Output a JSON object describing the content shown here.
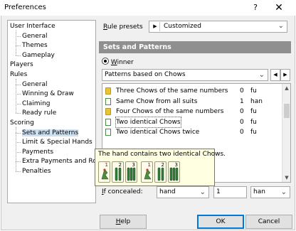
{
  "window": {
    "title": "Preferences",
    "help_glyph": "?",
    "close_glyph": "✕"
  },
  "tree": [
    {
      "label": "User Interface",
      "level": 0
    },
    {
      "label": "General",
      "level": 1
    },
    {
      "label": "Themes",
      "level": 1
    },
    {
      "label": "Gameplay",
      "level": 1
    },
    {
      "label": "Players",
      "level": 0
    },
    {
      "label": "Rules",
      "level": 0
    },
    {
      "label": "General",
      "level": 1
    },
    {
      "label": "Winning & Draw",
      "level": 1
    },
    {
      "label": "Claiming",
      "level": 1
    },
    {
      "label": "Ready rule",
      "level": 1
    },
    {
      "label": "Scoring",
      "level": 0
    },
    {
      "label": "Sets and Patterns",
      "level": 1,
      "selected": true
    },
    {
      "label": "Limit & Special Hands",
      "level": 1
    },
    {
      "label": "Payments",
      "level": 1
    },
    {
      "label": "Extra Payments and Rou",
      "level": 1
    },
    {
      "label": "Penalties",
      "level": 1
    }
  ],
  "rule_presets": {
    "label_underlined": "R",
    "label_rest": "ule presets",
    "value": "Customized"
  },
  "section": {
    "title": "Sets and Patterns"
  },
  "winner": {
    "label_underlined": "W",
    "label_rest": "inner"
  },
  "pattern_select": {
    "value": "Patterns based on Chows"
  },
  "patterns": [
    {
      "icon": "bamboo-icon",
      "name": "Three Chows of the same numbers",
      "value": "0",
      "unit": "fu"
    },
    {
      "icon": "dots-icon",
      "name": "Same Chow from all suits",
      "value": "1",
      "unit": "han"
    },
    {
      "icon": "bamboo-icon",
      "name": "Four Chows of the same numbers",
      "value": "0",
      "unit": "fu"
    },
    {
      "icon": "dots-icon",
      "name": "Two identical Chows",
      "value": "0",
      "unit": "fu",
      "selected": true
    },
    {
      "icon": "dots-icon",
      "name": "Two identical Chows twice",
      "value": "0",
      "unit": "fu"
    }
  ],
  "tooltip": {
    "text": "The hand contains two identical Chows.",
    "tiles": [
      {
        "number": "1",
        "color": "red"
      },
      {
        "number": "2",
        "color": "black"
      },
      {
        "number": "3",
        "color": "black"
      },
      {
        "number": "1",
        "color": "red"
      },
      {
        "number": "2",
        "color": "black"
      },
      {
        "number": "3",
        "color": "black"
      }
    ]
  },
  "concealed": {
    "label_underlined": "I",
    "label_rest": "f concealed:",
    "mode": "hand",
    "amount": "1",
    "unit": "han"
  },
  "buttons": {
    "help_underlined": "H",
    "help_rest": "elp",
    "ok": "OK",
    "cancel": "Cancel"
  }
}
